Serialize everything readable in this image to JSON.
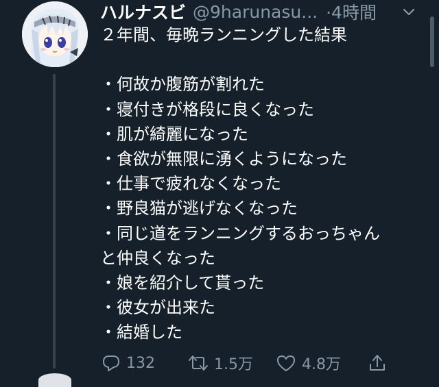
{
  "tweet": {
    "display_name": "ハルナスビ",
    "handle": "@9harunasu...",
    "time": "·4時間",
    "body": "２年間、毎晩ランニングした結果\n\n・何故か腹筋が割れた\n・寝付きが格段に良くなった\n・肌が綺麗になった\n・食欲が無限に湧くようになった\n・仕事で疲れなくなった\n・野良猫が逃げなくなった\n・同じ道をランニングするおっちゃん\nと仲良くなった\n・娘を紹介して貰った\n・彼女が出来た\n・結婚した",
    "replies": "132",
    "retweets": "1.5万",
    "likes": "4.8万"
  },
  "colors": {
    "background": "#15202b",
    "secondary_text": "#8899a6",
    "thread_line": "#38444d"
  },
  "icons": {
    "reply": "speech-bubble-icon",
    "retweet": "retweet-arrows-icon",
    "like": "heart-outline-icon",
    "share": "share-upload-icon",
    "menu": "chevron-down-icon"
  }
}
